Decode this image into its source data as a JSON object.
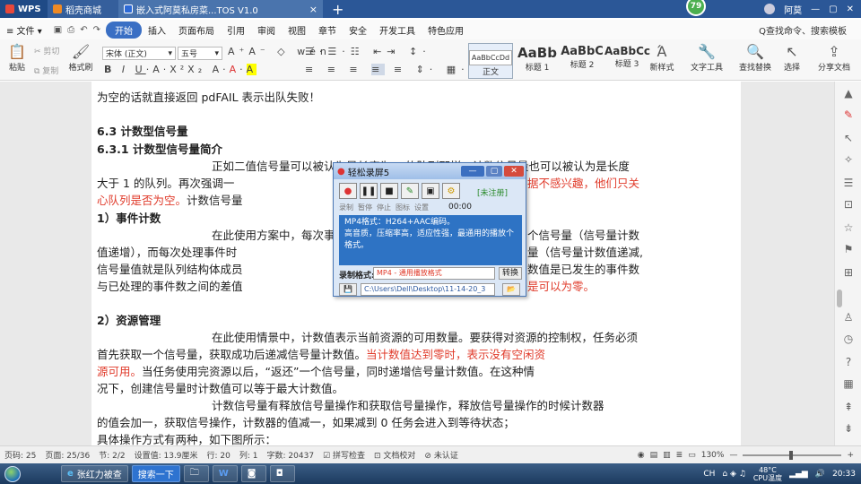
{
  "tabs": {
    "wps": "WPS",
    "mall": "稻壳商城",
    "doc": "嵌入式阿莫私房菜...TOS V1.0",
    "close": "×",
    "new": "+"
  },
  "topright": {
    "badge": "79",
    "user": "阿莫"
  },
  "menubar": {
    "file": "≡ 文件 ▾",
    "items": [
      "开始",
      "插入",
      "页面布局",
      "引用",
      "审阅",
      "视图",
      "章节",
      "安全",
      "开发工具",
      "特色应用"
    ],
    "search": "Q查找命令、搜索模板"
  },
  "ribbon": {
    "paste": "粘贴",
    "cut": "剪切",
    "copy": "复制",
    "format_painter": "格式刷",
    "font": "宋体 (正文)",
    "size": "五号",
    "styles": [
      {
        "preview": "AaBbCcDd",
        "label": "正文"
      },
      {
        "preview": "AaBb",
        "label": "标题 1"
      },
      {
        "preview": "AaBbC",
        "label": "标题 2"
      },
      {
        "preview": "AaBbCc",
        "label": "标题 3"
      }
    ],
    "new_style": "新样式",
    "text_tools": "文字工具",
    "find_replace": "查找替换",
    "select": "选择",
    "share": "分享文档"
  },
  "doc": {
    "line1": "为空的话就直接返回 pdFAIL 表示出队失败！",
    "h_63": "6.3 计数型信号量",
    "h_631": "6.3.1 计数型信号量简介",
    "p1a": "正如二值信号量可以被认为是长度为 1 的队列那样，计数信号量也可以被认为是长度",
    "p1b_pre": "大于 1 的队列。再次强调一",
    "p1b_red": "据不感兴趣，他们只关",
    "p1c_red": "心队列是否为空。",
    "p1c_post": "计数信号量",
    "h_event": "1）事件计数",
    "p2a_pre": "在此使用方案中，每次事",
    "p2a_post": "个信号量（信号量计数",
    "p2b_pre": "值递增），而每次处理事件时",
    "p2b_post": "量（信号量计数值递减,",
    "p2c_pre": "信号量值就是队列结构体成员",
    "p2c_post": "数值是已发生的事件数",
    "p2d_pre": "与已处理的事件数之间的差值",
    "p2d_red": "是可以为零。",
    "h_res": "2）资源管理",
    "p3a": "在此使用情景中，计数值表示当前资源的可用数量。要获得对资源的控制权，任务必须",
    "p3b_pre": "首先获取一个信号量，获取成功后递减信号量计数值。",
    "p3b_red": "当计数值达到零时，表示没有空闲资",
    "p3c_red": "源可用。",
    "p3c_post": "当任务使用完资源以后，“返还”一个信号量，同时递增信号量计数值。在这种情",
    "p3d": "况下，创建信号量时计数值可以等于最大计数值。",
    "p4a": "计数信号量有释放信号量操作和获取信号量操作，释放信号量操作的时候计数器",
    "p4b": "的值会加一，获取信号操作，计数器的值减一，如果减到 0 任务会进入到等待状态；",
    "p4c": "具体操作方式有两种，如下图所示："
  },
  "recorder": {
    "title": "轻松录屏5",
    "unregistered": "[未注册]",
    "labels": [
      "录制",
      "暂停",
      "停止",
      "图标",
      "设置"
    ],
    "time": "00:00",
    "info1": "MP4格式：H264+AAC编码。",
    "info2": "高音质，压缩率高，适应性强，最通用的播放个格式。",
    "format_label": "录制格式:",
    "format_value": "MP4 - 通用播放格式",
    "convert": "转换",
    "path": "C:\\Users\\Dell\\Desktop\\11-14-20_3"
  },
  "status": {
    "page": "页码: 25",
    "pages": "页面: 25/36",
    "section": "节: 2/2",
    "setting": "设置值: 13.9厘米",
    "row": "行: 20",
    "col": "列: 1",
    "words": "字数: 20437",
    "spell": "拼写检查",
    "proof": "文档校对",
    "cert": "未认证",
    "zoom": "130%"
  },
  "taskbar": {
    "ie_task": "张红力被查",
    "search_task": "搜索一下",
    "temp": "48°C",
    "cpu": "CPU温度",
    "clock": "20:33",
    "lang": "CH"
  }
}
